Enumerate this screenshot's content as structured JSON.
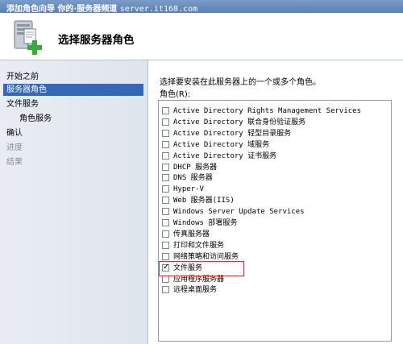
{
  "window": {
    "title": "添加角色向导",
    "watermark_prefix": "你的·服务器频道",
    "watermark_site": "server.it168.com"
  },
  "header": {
    "title": "选择服务器角色",
    "icon": "server-add-icon"
  },
  "nav": {
    "items": [
      {
        "label": "开始之前",
        "state": "normal"
      },
      {
        "label": "服务器角色",
        "state": "selected"
      },
      {
        "label": "文件服务",
        "state": "normal"
      },
      {
        "label": "角色服务",
        "state": "sub"
      },
      {
        "label": "确认",
        "state": "normal"
      },
      {
        "label": "进度",
        "state": "disabled"
      },
      {
        "label": "结果",
        "state": "disabled"
      }
    ]
  },
  "main": {
    "instruction": "选择要安装在此服务器上的一个或多个角色。",
    "roles_label": "角色(R):",
    "roles": [
      {
        "label": "Active Directory Rights Management Services",
        "checked": false
      },
      {
        "label": "Active Directory 联合身份验证服务",
        "checked": false
      },
      {
        "label": "Active Directory 轻型目录服务",
        "checked": false
      },
      {
        "label": "Active Directory 域服务",
        "checked": false
      },
      {
        "label": "Active Directory 证书服务",
        "checked": false
      },
      {
        "label": "DHCP 服务器",
        "checked": false
      },
      {
        "label": "DNS 服务器",
        "checked": false
      },
      {
        "label": "Hyper-V",
        "checked": false
      },
      {
        "label": "Web 服务器(IIS)",
        "checked": false
      },
      {
        "label": "Windows Server Update Services",
        "checked": false
      },
      {
        "label": "Windows 部署服务",
        "checked": false
      },
      {
        "label": "传真服务器",
        "checked": false
      },
      {
        "label": "打印和文件服务",
        "checked": false
      },
      {
        "label": "网络策略和访问服务",
        "checked": false
      },
      {
        "label": "文件服务",
        "checked": true
      },
      {
        "label": "应用程序服务器",
        "checked": false
      },
      {
        "label": "远程桌面服务",
        "checked": false
      }
    ]
  },
  "colors": {
    "selection": "#3569b8",
    "highlight_box": "#d9322e",
    "pane_bg": "#e4e9f0"
  }
}
